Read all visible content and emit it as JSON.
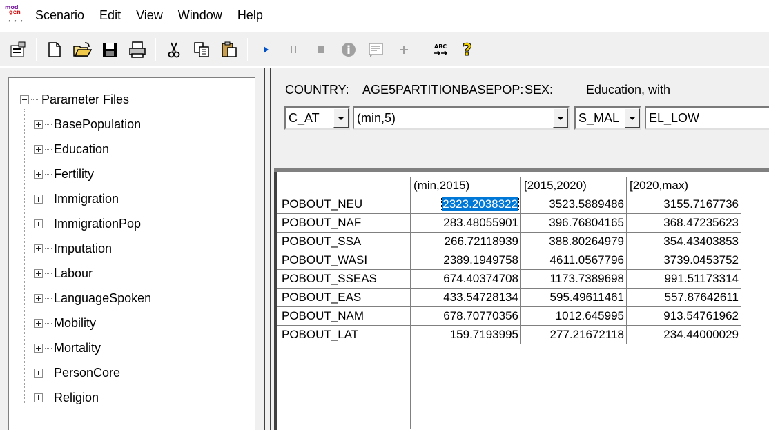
{
  "app": {
    "icon_text_top": "mod",
    "icon_text_bottom": "gen",
    "icon_arrows": "→→→"
  },
  "menu": {
    "items": [
      "Scenario",
      "Edit",
      "View",
      "Window",
      "Help"
    ]
  },
  "toolbar": {
    "buttons": [
      "properties-icon",
      "new-file-icon",
      "open-folder-icon",
      "save-icon",
      "print-icon",
      "cut-icon",
      "copy-icon",
      "paste-icon",
      "run-icon",
      "pause-icon",
      "stop-icon",
      "info-icon",
      "log-icon",
      "add-icon",
      "spell-check-icon",
      "help-icon"
    ]
  },
  "tree": {
    "root": "Parameter Files",
    "children": [
      "BasePopulation",
      "Education",
      "Fertility",
      "Immigration",
      "ImmigrationPop",
      "Imputation",
      "Labour",
      "LanguageSpoken",
      "Mobility",
      "Mortality",
      "PersonCore",
      "Religion"
    ]
  },
  "dimensions": {
    "labels": [
      "COUNTRY:",
      "AGE5PARTITIONBASEPOP:",
      "SEX:",
      "Education, with"
    ],
    "values": [
      "C_AT",
      "(min,5)",
      "S_MAL",
      "EL_LOW"
    ]
  },
  "grid": {
    "columns": [
      "(min,2015)",
      "[2015,2020)",
      "[2020,max)"
    ],
    "rows": [
      {
        "label": "POBOUT_NEU",
        "values": [
          "2323.2038322",
          "3523.5889486",
          "3155.7167736"
        ]
      },
      {
        "label": "POBOUT_NAF",
        "values": [
          "283.48055901",
          "396.76804165",
          "368.47235623"
        ]
      },
      {
        "label": "POBOUT_SSA",
        "values": [
          "266.72118939",
          "388.80264979",
          "354.43403853"
        ]
      },
      {
        "label": "POBOUT_WASI",
        "values": [
          "2389.1949758",
          "4611.0567796",
          "3739.0453752"
        ]
      },
      {
        "label": "POBOUT_SSEAS",
        "values": [
          "674.40374708",
          "1173.7389698",
          "991.51173314"
        ]
      },
      {
        "label": "POBOUT_EAS",
        "values": [
          "433.54728134",
          "595.49611461",
          "557.87642611"
        ]
      },
      {
        "label": "POBOUT_NAM",
        "values": [
          "678.70770356",
          "1012.645995",
          "913.54761962"
        ]
      },
      {
        "label": "POBOUT_LAT",
        "values": [
          "159.7193995",
          "277.21672118",
          "234.44000029"
        ]
      }
    ],
    "selected_cell": "2323.2038322"
  },
  "colors": {
    "selection": "#0078d7",
    "chrome": "#f0f0f0"
  }
}
